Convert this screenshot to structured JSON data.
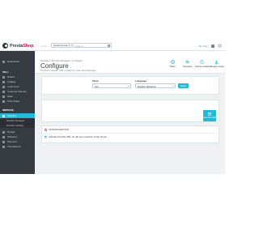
{
  "topbar": {
    "logo_prefix": "Presta",
    "logo_suffix": "Shop",
    "version": "1.7.x",
    "quick_access": "Quick Access ▾",
    "search_placeholder": "Search",
    "shop_link": "My shop",
    "user": "Admin"
  },
  "sidebar": {
    "collapse_label": "Dashboard",
    "sections": [
      {
        "title": "SELL",
        "items": [
          "Orders",
          "Catalog",
          "Customers",
          "Customer Service",
          "Stats",
          "Price Rules"
        ]
      },
      {
        "title": "IMPROVE",
        "items": [
          "Modules"
        ],
        "sub_items": [
          "Module Manager",
          "Module Catalog"
        ]
      },
      {
        "extra_items": [
          "Design",
          "Shipping",
          "Payment",
          "International"
        ]
      }
    ]
  },
  "header": {
    "breadcrumb": [
      "Modules",
      "Module Manager",
      "Configure"
    ],
    "title": "Configure",
    "subtitle": "Product Friendly URL update by shop and language",
    "toolbar": [
      {
        "label": "Back",
        "icon": "back-icon"
      },
      {
        "label": "Translate",
        "icon": "translate-icon"
      },
      {
        "label": "Check update",
        "icon": "refresh-icon"
      },
      {
        "label": "Manage hooks",
        "icon": "download-icon"
      }
    ]
  },
  "filter": {
    "shop_label": "Shop",
    "shop_value": "ALL",
    "language_label": "Language",
    "language_value": "English (English)",
    "apply_label": "Apply"
  },
  "content": {
    "add_label": "Create URL Update"
  },
  "configuration": {
    "title": "Configuration",
    "checkbox_label": "Activate friendly URL for all new products of the shops",
    "checked": true
  },
  "colors": {
    "accent": "#25b9d7",
    "sidebar": "#363a41",
    "brand": "#df0067"
  }
}
